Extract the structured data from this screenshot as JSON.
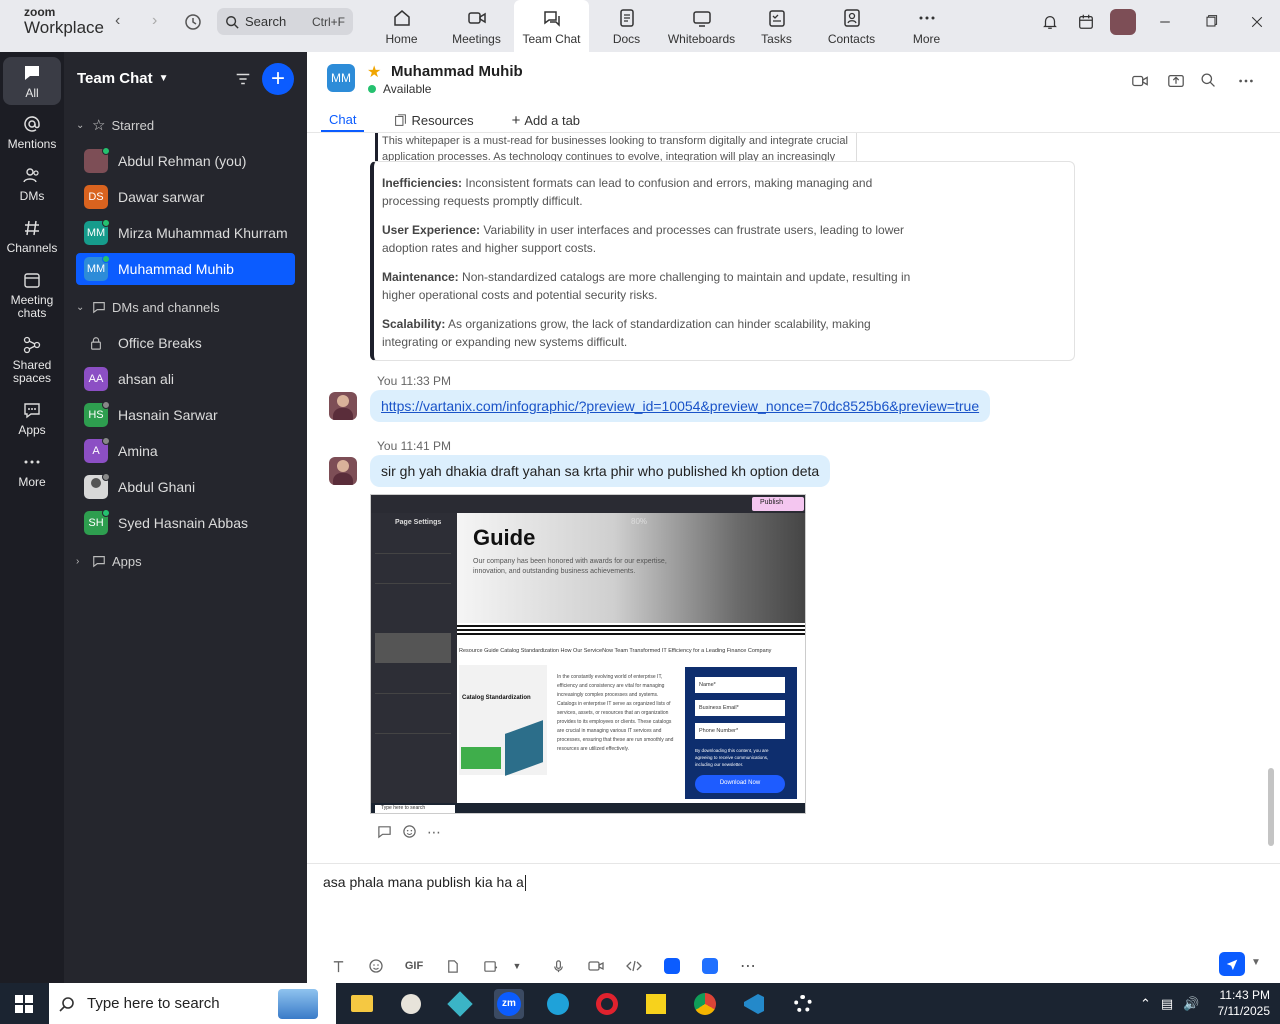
{
  "app": {
    "logo_line1": "zoom",
    "logo_line2": "Workplace"
  },
  "search": {
    "label": "Search",
    "shortcut": "Ctrl+F"
  },
  "topnav": [
    {
      "label": "Home",
      "icon": "home-icon"
    },
    {
      "label": "Meetings",
      "icon": "video-icon"
    },
    {
      "label": "Team Chat",
      "icon": "chat-icon"
    },
    {
      "label": "Docs",
      "icon": "doc-icon"
    },
    {
      "label": "Whiteboards",
      "icon": "whiteboard-icon"
    },
    {
      "label": "Tasks",
      "icon": "tasks-icon"
    },
    {
      "label": "Contacts",
      "icon": "contacts-icon"
    },
    {
      "label": "More",
      "icon": "more-icon"
    }
  ],
  "rail": [
    {
      "label": "All"
    },
    {
      "label": "Mentions"
    },
    {
      "label": "DMs"
    },
    {
      "label": "Channels"
    },
    {
      "label": "Meeting chats"
    },
    {
      "label": "Shared spaces"
    },
    {
      "label": "Apps"
    },
    {
      "label": "More"
    }
  ],
  "sidebar": {
    "title": "Team Chat",
    "starred_label": "Starred",
    "starred": [
      {
        "name": "Abdul Rehman (you)",
        "initials": "",
        "color": "#7d4e56",
        "photo": true,
        "status": "online"
      },
      {
        "name": "Dawar sarwar",
        "initials": "DS",
        "color": "#d9631f",
        "status": "none"
      },
      {
        "name": "Mirza Muhammad Khurram",
        "initials": "MM",
        "color": "#169c8c",
        "status": "online"
      },
      {
        "name": "Muhammad Muhib",
        "initials": "MM",
        "color": "#2d8cd8",
        "status": "online",
        "selected": true
      }
    ],
    "dms_label": "DMs and channels",
    "dms": [
      {
        "name": "Office Breaks",
        "initials": "",
        "lock": true
      },
      {
        "name": "ahsan ali",
        "initials": "AA",
        "color": "#8c4fc4",
        "status": "none"
      },
      {
        "name": "Hasnain Sarwar",
        "initials": "HS",
        "color": "#2e9e4f",
        "status": "grey"
      },
      {
        "name": "Amina",
        "initials": "A",
        "color": "#8c4fc4",
        "status": "grey"
      },
      {
        "name": "Abdul Ghani",
        "initials": "",
        "color": "#d8d8d8",
        "photo": true,
        "status": "grey"
      },
      {
        "name": "Syed Hasnain Abbas",
        "initials": "SH",
        "color": "#2e9e4f",
        "status": "online"
      }
    ],
    "apps_label": "Apps"
  },
  "chat": {
    "initials": "MM",
    "name": "Muhammad Muhib",
    "status": "Available",
    "tabs": [
      {
        "label": "Chat"
      },
      {
        "label": "Resources"
      },
      {
        "label": "Add a tab"
      }
    ],
    "fragment": "This whitepaper is a must-read for businesses looking to transform digitally and integrate crucial application processes. As technology continues to evolve, integration will play an increasingly impo",
    "quote": [
      {
        "title": "Inefficiencies:",
        "text": "Inconsistent formats can lead to confusion and errors, making managing and processing requests promptly difficult."
      },
      {
        "title": "User Experience:",
        "text": "Variability in user interfaces and processes can frustrate users, leading to lower adoption rates and higher support costs."
      },
      {
        "title": "Maintenance:",
        "text": "Non-standardized catalogs are more challenging to maintain and update, resulting in higher operational costs and potential security risks."
      },
      {
        "title": "Scalability:",
        "text": "As organizations grow, the lack of standardization can hinder scalability, making integrating or expanding new systems difficult."
      }
    ],
    "messages": [
      {
        "meta": "You 11:33 PM",
        "link": "https://vartanix.com/infographic/?preview_id=10054&preview_nonce=70dc8525b6&preview=true"
      },
      {
        "meta": "You 11:41 PM",
        "text": "sir gh yah dhakia draft yahan sa krta phir who published kh option deta"
      }
    ],
    "screenshot": {
      "title": "Guide",
      "subtitle": "Our company has been honored with awards for our expertise, innovation, and outstanding business achievements.",
      "breadcrumb": "Resource Guide Catalog Standardization  How Our ServiceNow Team Transformed IT Efficiency for a Leading Finance Company",
      "page_settings": "Page Settings",
      "catalog_title": "Catalog Standardization",
      "body": "In the constantly evolving world of enterprise IT, efficiency and consistency are vital for managing increasingly complex processes and systems. Catalogs in enterprise IT serve as organized lists of services, assets, or resources that an organization provides to its employees or clients. These catalogs are crucial in managing various IT services and processes, ensuring that these are run smoothly and resources are utilized effectively.",
      "form": {
        "name": "Name*",
        "email": "Business Email*",
        "phone": "Phone Number*",
        "note": "By downloading this content, you are agreeing to receive communications, including our newsletter.",
        "button": "Download Now"
      },
      "publish": "Publish",
      "zoom": "80%",
      "bottom_search": "Type here to search"
    },
    "composer": {
      "text": "asa phala mana publish kia ha a"
    }
  },
  "taskbar": {
    "search": "Type here to search",
    "time": "11:43 PM",
    "date": "7/11/2025"
  }
}
